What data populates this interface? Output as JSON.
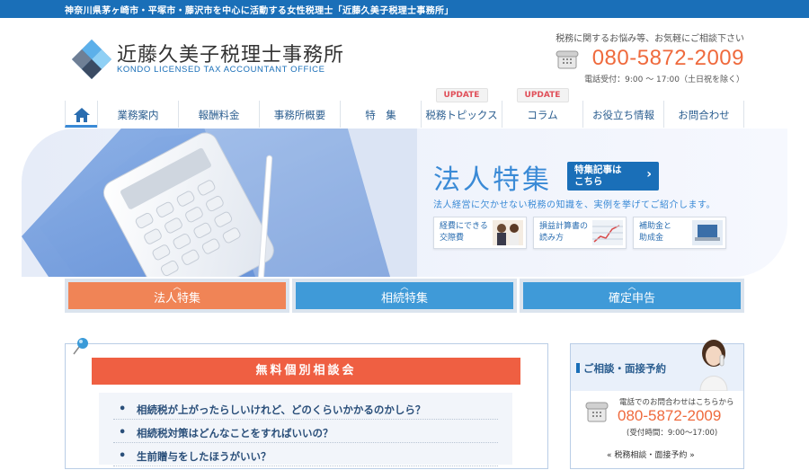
{
  "topbar": {
    "text": "神奈川県茅ヶ崎市・平塚市・藤沢市を中心に活動する女性税理士「近藤久美子税理士事務所」"
  },
  "logo": {
    "name_jp": "近藤久美子税理士事務所",
    "name_en": "KONDO LICENSED TAX ACCOUNTANT OFFICE"
  },
  "contact": {
    "message": "税務に関するお悩み等、お気軽にご相談下さい",
    "phone": "080-5872-2009",
    "hours": "電話受付：9:00 〜 17:00（土日祝を除く）"
  },
  "nav": {
    "items": [
      {
        "label": ""
      },
      {
        "label": "業務案内"
      },
      {
        "label": "報酬料金"
      },
      {
        "label": "事務所概要"
      },
      {
        "label": "特　集"
      },
      {
        "label": "税務トピックス",
        "badge": "UPDATE"
      },
      {
        "label": "コラム",
        "badge": "UPDATE"
      },
      {
        "label": "お役立ち情報"
      },
      {
        "label": "お問合わせ"
      }
    ]
  },
  "hero": {
    "title": "法人特集",
    "button_line1": "特集記事は",
    "button_line2": "こちら",
    "subtitle": "法人経営に欠かせない税務の知識を、実例を挙げてご紹介します。",
    "features": [
      {
        "line1": "経費にできる",
        "line2": "交際費"
      },
      {
        "line1": "損益計算書の",
        "line2": "読み方"
      },
      {
        "line1": "補助金と",
        "line2": "助成金"
      }
    ]
  },
  "categories": [
    {
      "label": "法人特集",
      "color": "#f08456"
    },
    {
      "label": "相続特集",
      "color": "#3f9ad8"
    },
    {
      "label": "確定申告",
      "color": "#3f9ad8"
    }
  ],
  "consult": {
    "header": "無料個別相談会",
    "questions": [
      "相続税が上がったらしいけれど、どのくらいかかるのかしら？",
      "相続税対策はどんなことをすればいいの？",
      "生前贈与をしたほうがいい？"
    ]
  },
  "sidebar": {
    "title": "ご相談・面接予約",
    "call_label": "電話でのお問合わせはこちらから",
    "phone": "080-5872-2009",
    "hours": "(受付時間：9:00〜17:00)",
    "link": "« 税務相談・面接予約 »"
  }
}
